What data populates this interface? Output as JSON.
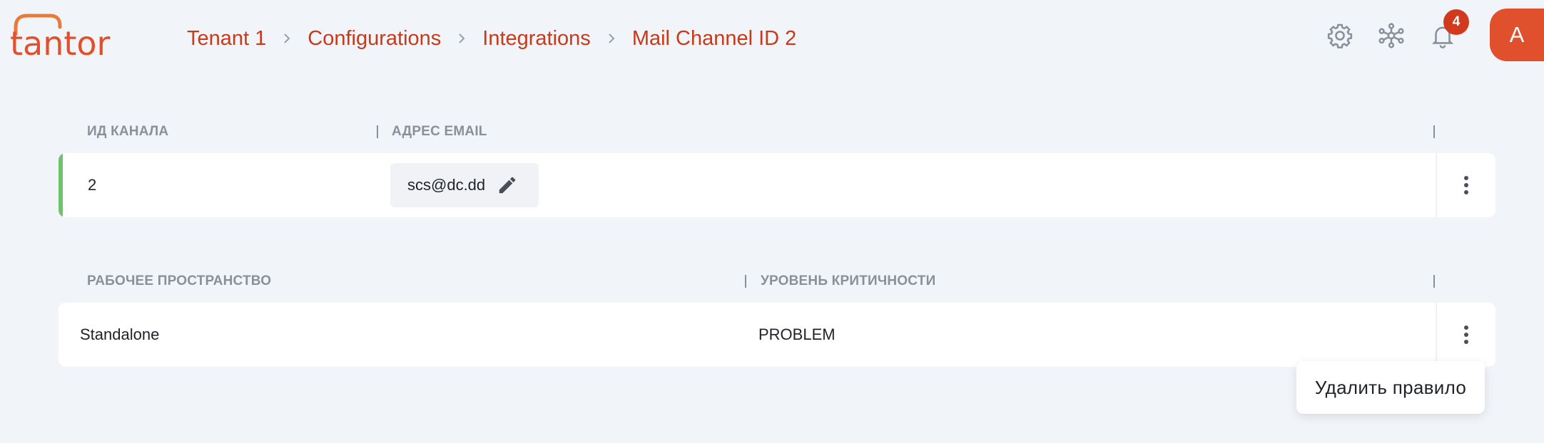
{
  "header": {
    "logo_text": "tantor",
    "breadcrumbs": [
      {
        "label": "Tenant 1"
      },
      {
        "label": "Configurations"
      },
      {
        "label": "Integrations"
      },
      {
        "label": "Mail Channel ID 2"
      }
    ],
    "icons": [
      "gear-icon",
      "network-icon",
      "bell-icon"
    ],
    "notification_count": "4",
    "avatar_letter": "A"
  },
  "channel_table": {
    "columns": [
      "ИД КАНАЛА",
      "АДРЕС EMAIL"
    ],
    "row": {
      "id": "2",
      "email": "scs@dc.dd",
      "status_color": "#6cc46a"
    }
  },
  "rules_table": {
    "columns": [
      "РАБОЧЕЕ ПРОСТРАНСТВО",
      "УРОВЕНЬ КРИТИЧНОСТИ"
    ],
    "row": {
      "workspace": "Standalone",
      "severity": "PROBLEM"
    }
  },
  "context_menu": {
    "items": [
      "Удалить правило"
    ]
  },
  "colors": {
    "accent": "#c73a1a",
    "avatar": "#e0502c",
    "badge": "#d23a1e",
    "background": "#f1f4f9"
  }
}
